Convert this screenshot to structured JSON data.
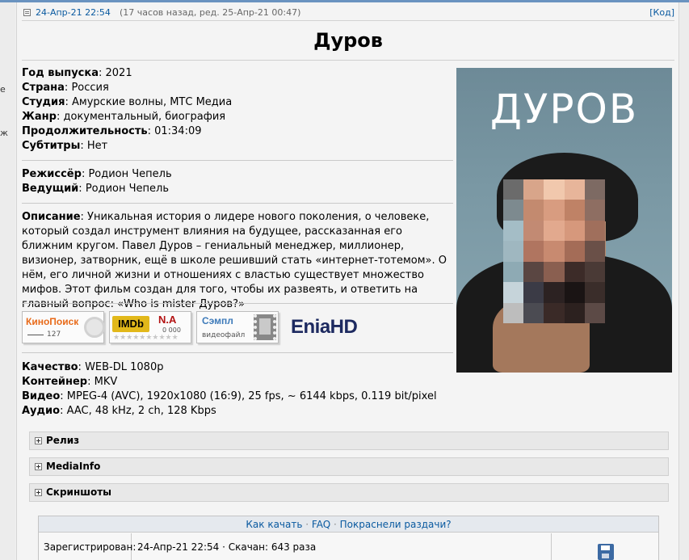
{
  "gutter": {
    "text1": "е",
    "text2": "ж"
  },
  "post": {
    "date": "24-Апр-21 22:54",
    "edited": "(17 часов назад, ред. 25-Апр-21 00:47)",
    "code_link": "[Код]",
    "title": "Дуров"
  },
  "info": {
    "year_label": "Год выпуска",
    "year": "2021",
    "country_label": "Страна",
    "country": "Россия",
    "studio_label": "Студия",
    "studio": "Амурские волны, МТС Медиа",
    "genre_label": "Жанр",
    "genre": "документальный, биография",
    "duration_label": "Продолжительность",
    "duration": "01:34:09",
    "subs_label": "Субтитры",
    "subs": "Нет",
    "director_label": "Режиссёр",
    "director": "Родион Чепель",
    "host_label": "Ведущий",
    "host": "Родион Чепель",
    "desc_label": "Описание",
    "desc_text": "Уникальная история о лидере нового поколения, о человеке, который создал инструмент влияния на будущее, рассказанная его ближним кругом. Павел Дуров – гениальный менеджер, миллионер, визионер, затворник, ещё в школе решивший стать «интернет-тотемом». О нём, его личной жизни и отношениях с властью существует множество мифов. Этот фильм создан для того, чтобы их развеять, и ответить на главный вопрос: «Who is mister Дуров?»"
  },
  "poster": {
    "title": "ДУРОВ"
  },
  "badges": {
    "kinopoisk": "КиноПоиск",
    "kinopoisk_count": "127",
    "imdb": "IMDb",
    "imdb_na": "N.A",
    "imdb_count": "0 000",
    "stars": "★★★★★★★★★★",
    "sample": "Сэмпл",
    "sample_sub": "видеофайл",
    "enia": "EniaHD"
  },
  "tech": {
    "quality_label": "Качество",
    "quality": "WEB-DL 1080p",
    "container_label": "Контейнер",
    "container": "MKV",
    "video_label": "Видео",
    "video": "MPEG-4 (AVC), 1920x1080 (16:9), 25 fps, ~ 6144 kbps, 0.119 bit/pixel",
    "audio_label": "Аудио",
    "audio": "AAC, 48 kHz, 2 ch, 128 Kbps"
  },
  "spoilers": [
    "Релиз",
    "MediaInfo",
    "Скриншоты"
  ],
  "download": {
    "how": "Как качать",
    "faq": "FAQ",
    "red": "Покраснели раздачи?",
    "dot": "·",
    "reg_label": "Зарегистрирован:",
    "reg_info": "24-Апр-21 22:54 · Скачан: 643 раза"
  }
}
